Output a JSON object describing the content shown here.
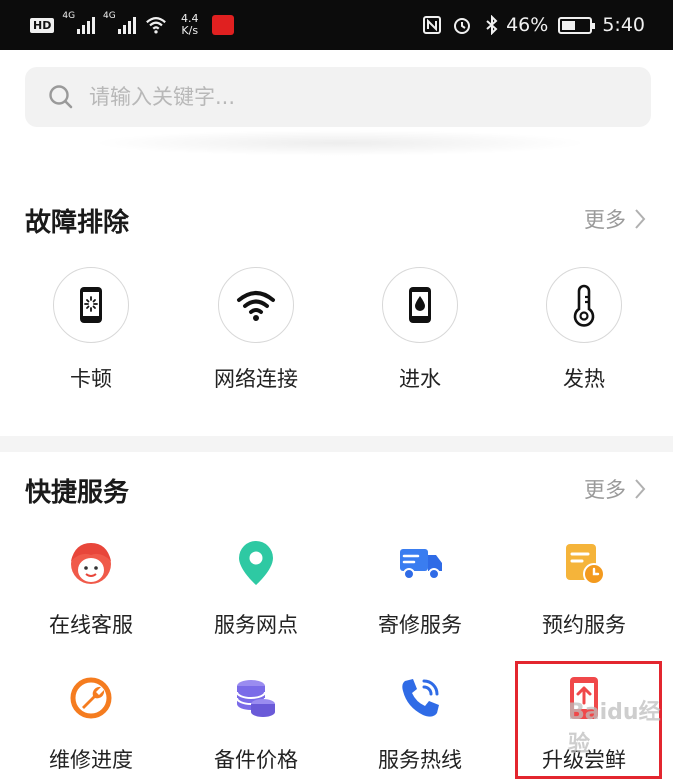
{
  "status_bar": {
    "hd": "HD",
    "net1": "4G",
    "net2": "4G",
    "speed_top": "4.4",
    "speed_bottom": "K/s",
    "battery": "46%",
    "time": "5:40"
  },
  "search": {
    "placeholder": "请输入关键字..."
  },
  "troubleshoot": {
    "title": "故障排除",
    "more": "更多",
    "items": [
      {
        "label": "卡顿",
        "icon": "phone-lag-icon"
      },
      {
        "label": "网络连接",
        "icon": "wifi-icon"
      },
      {
        "label": "进水",
        "icon": "phone-water-icon"
      },
      {
        "label": "发热",
        "icon": "thermometer-icon"
      }
    ]
  },
  "quick_services": {
    "title": "快捷服务",
    "more": "更多",
    "items": [
      {
        "label": "在线客服",
        "icon": "customer-service-icon",
        "color": "#f05a4a"
      },
      {
        "label": "服务网点",
        "icon": "location-pin-icon",
        "color": "#2ec9a3"
      },
      {
        "label": "寄修服务",
        "icon": "delivery-truck-icon",
        "color": "#3a7df0"
      },
      {
        "label": "预约服务",
        "icon": "appointment-icon",
        "color": "#f5b43a"
      },
      {
        "label": "维修进度",
        "icon": "wrench-icon",
        "color": "#f57c1f"
      },
      {
        "label": "备件价格",
        "icon": "coins-icon",
        "color": "#7a6be8"
      },
      {
        "label": "服务热线",
        "icon": "phone-call-icon",
        "color": "#2f6be6"
      },
      {
        "label": "升级尝鲜",
        "icon": "upgrade-icon",
        "color": "#f0484a"
      }
    ]
  },
  "watermark": "Baidu经验",
  "colors": {
    "highlight": "#e3262f",
    "background": "#ffffff",
    "statusbar": "#0c0c0c"
  }
}
